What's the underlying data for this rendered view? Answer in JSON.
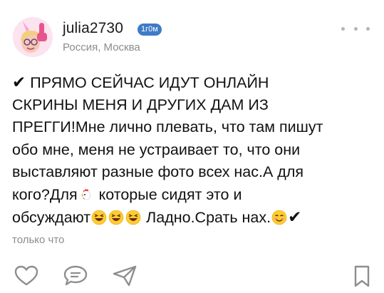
{
  "header": {
    "username": "julia2730",
    "time_badge": "1г0м",
    "location": "Россия, Москва"
  },
  "post": {
    "lines": [
      {
        "pre": "✔",
        "text": " ПРЯМО СЕЙЧАС ИДУТ ОНЛАЙН"
      },
      {
        "text": "СКРИНЫ МЕНЯ И ДРУГИХ ДАМ ИЗ"
      },
      {
        "text": "ПРЕГГИ!Мне лично плевать, что там пишут"
      },
      {
        "text": "обо мне, меня не устраивает то, что они"
      },
      {
        "text": "выставляют разные фото всех нас.А для"
      },
      {
        "a": "кого?Для",
        "b": " которые сидят это и"
      },
      {
        "a": "обсуждают",
        "b": " Ладно.Срать нах.",
        "end": "✔"
      }
    ],
    "timestamp": "только что"
  },
  "colors": {
    "badge": "#3f7bc6",
    "secondary_text": "#8c8c8c",
    "icon": "#8e8e8e"
  },
  "actions": [
    "heart-icon",
    "comment-icon",
    "share-icon",
    "bookmark-icon"
  ]
}
